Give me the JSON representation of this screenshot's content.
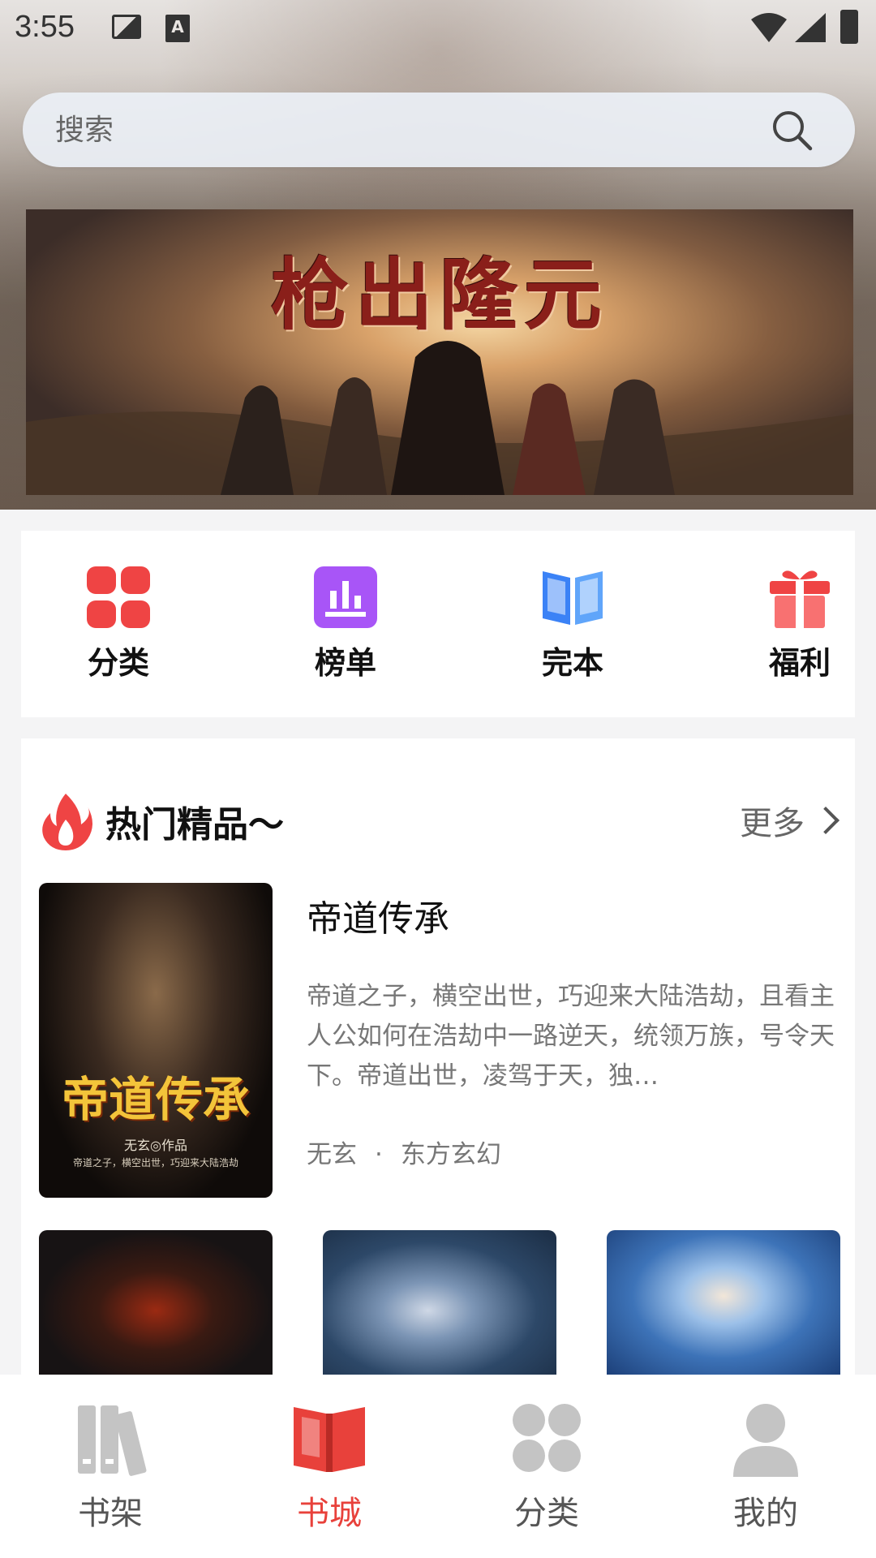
{
  "status_bar": {
    "time": "3:55",
    "app_badge": "A"
  },
  "search": {
    "placeholder": "搜索"
  },
  "banner": {
    "title": "枪出隆元"
  },
  "quick_menu": [
    {
      "label": "分类",
      "icon": "grid-icon",
      "color": "#ef4444"
    },
    {
      "label": "榜单",
      "icon": "chart-icon",
      "color": "#a855f7"
    },
    {
      "label": "完本",
      "icon": "book-open-icon",
      "color": "#3b82f6"
    },
    {
      "label": "福利",
      "icon": "gift-icon",
      "color": "#ef4444"
    }
  ],
  "hot": {
    "title": "热门精品～",
    "more_label": "更多",
    "featured": {
      "title": "帝道传承",
      "description": "帝道之子，横空出世，巧迎来大陆浩劫，且看主人公如何在浩劫中一路逆天，统领万族，号令天下。帝道出世，凌驾于天，独…",
      "author": "无玄",
      "separator": "·",
      "genre": "东方玄幻",
      "cover": {
        "title": "帝道传承",
        "subtitle": "无玄◎作品",
        "tagline": "帝道之子，横空出世，巧迎来大陆浩劫"
      }
    }
  },
  "bottom_nav": [
    {
      "label": "书架",
      "icon": "bookshelf-icon",
      "active": false
    },
    {
      "label": "书城",
      "icon": "book-icon",
      "active": true
    },
    {
      "label": "分类",
      "icon": "category-icon",
      "active": false
    },
    {
      "label": "我的",
      "icon": "user-icon",
      "active": false
    }
  ],
  "colors": {
    "accent": "#e8413b",
    "inactive": "#c4c4c4"
  }
}
